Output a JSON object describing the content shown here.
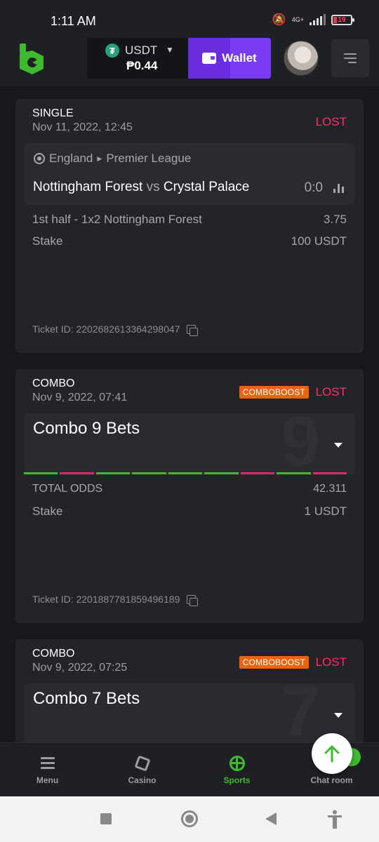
{
  "status_bar": {
    "time": "1:11 AM",
    "network": "4G+",
    "battery": "19"
  },
  "header": {
    "currency": "USDT",
    "balance": "₱0.44",
    "wallet_label": "Wallet"
  },
  "bets": [
    {
      "type": "SINGLE",
      "date": "Nov 11, 2022, 12:45",
      "result": "LOST",
      "league_country": "England",
      "league_name": "Premier League",
      "home": "Nottingham Forest",
      "vs": "vs",
      "away": "Crystal Palace",
      "score": "0:0",
      "selection": "1st half - 1x2 Nottingham Forest",
      "odds": "3.75",
      "stake_label": "Stake",
      "stake": "100 USDT",
      "ticket": "Ticket ID: 2202682613364298047"
    },
    {
      "type": "COMBO",
      "date": "Nov 9, 2022, 07:41",
      "boost": "COMBOBOOST",
      "result": "LOST",
      "combo_title": "Combo 9 Bets",
      "combo_count": "9",
      "legs": [
        "won",
        "lost",
        "won",
        "won",
        "won",
        "won",
        "lost",
        "won",
        "lost"
      ],
      "total_odds_label": "TOTAL ODDS",
      "total_odds": "42.311",
      "stake_label": "Stake",
      "stake": "1 USDT",
      "ticket": "Ticket ID: 2201887781859496189"
    },
    {
      "type": "COMBO",
      "date": "Nov 9, 2022, 07:25",
      "boost": "COMBOBOOST",
      "result": "LOST",
      "combo_title": "Combo 7 Bets",
      "combo_count": "7"
    }
  ],
  "leg_colors": {
    "won": "#3fba2f",
    "lost": "#e2236e"
  },
  "bottom_nav": [
    {
      "label": "Menu",
      "icon": "menu-icon"
    },
    {
      "label": "Casino",
      "icon": "casino-icon"
    },
    {
      "label": "Sports",
      "icon": "sports-icon",
      "active": true
    },
    {
      "label": "Chat room",
      "icon": "chat-icon"
    }
  ],
  "colors": {
    "accent": "#7a3cf0",
    "lost": "#ff2d6b",
    "boost": "#ea6412",
    "active_nav": "#3fba2f"
  }
}
